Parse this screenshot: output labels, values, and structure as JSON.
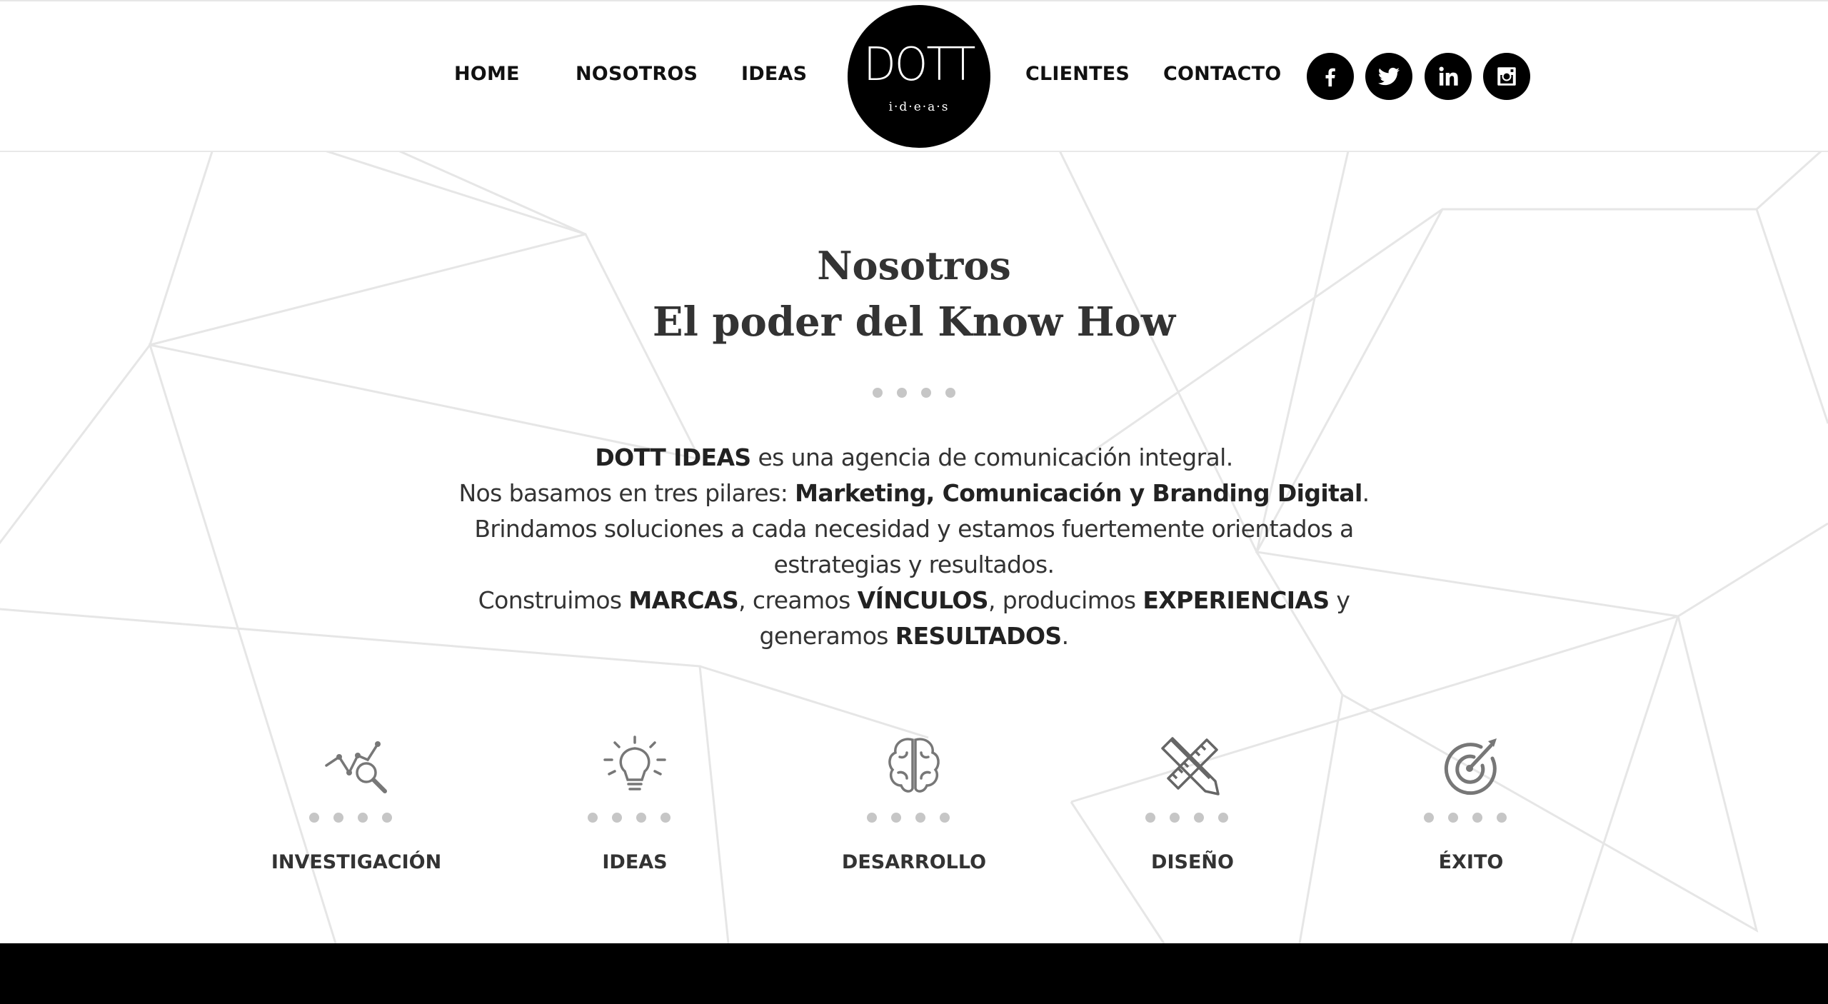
{
  "nav": {
    "home": "HOME",
    "nosotros": "NOSOTROS",
    "ideas": "IDEAS",
    "clientes": "CLIENTES",
    "contacto": "CONTACTO"
  },
  "logo": {
    "word": "DOTT",
    "sub": "i·d·e·a·s"
  },
  "social": [
    "facebook-icon",
    "twitter-icon",
    "linkedin-icon",
    "instagram-icon"
  ],
  "section": {
    "title": "Nosotros",
    "subtitle": "El poder del Know How"
  },
  "intro": {
    "l1_b": "DOTT IDEAS",
    "l1_t": " es una agencia de comunicación integral.",
    "l2_t": "Nos basamos en tres pilares: ",
    "l2_b": "Marketing, Comunicación y Branding Digital",
    "l2_end": ".",
    "l3": "Brindamos soluciones a cada necesidad y estamos fuertemente orientados a estrategias y resultados.",
    "l4_t1": "Construimos ",
    "l4_b1": "MARCAS",
    "l4_t2": ", creamos ",
    "l4_b2": "VÍNCULOS",
    "l4_t3": ", producimos ",
    "l4_b3": "EXPERIENCIAS",
    "l4_t4": " y generamos ",
    "l4_b4": "RESULTADOS",
    "l4_end": "."
  },
  "pillars": [
    {
      "label": "INVESTIGACIÓN",
      "icon": "chart-magnifier-icon"
    },
    {
      "label": "IDEAS",
      "icon": "lightbulb-icon"
    },
    {
      "label": "DESARROLLO",
      "icon": "brain-icon"
    },
    {
      "label": "DISEÑO",
      "icon": "pencil-ruler-icon"
    },
    {
      "label": "ÉXITO",
      "icon": "target-icon"
    }
  ],
  "colors": {
    "accent": "#000000",
    "text": "#333333",
    "dots": "#c6c6c6",
    "lines": "#e8e8e8"
  }
}
